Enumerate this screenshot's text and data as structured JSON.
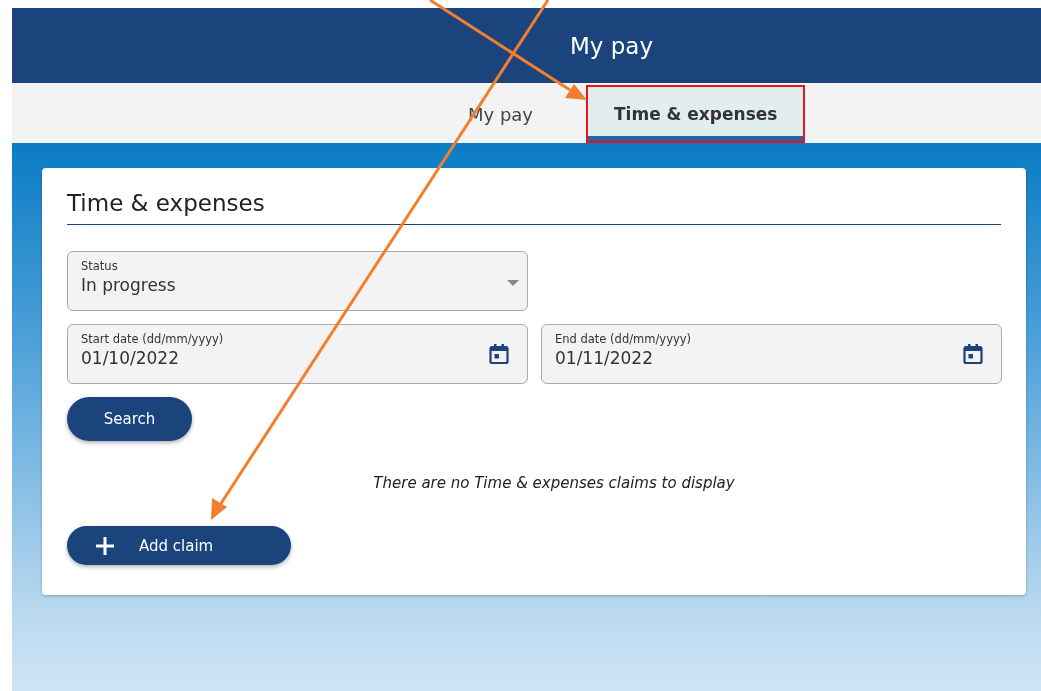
{
  "header": {
    "title": "My pay"
  },
  "tabs": [
    {
      "label": "My pay",
      "selected": false,
      "highlighted": false
    },
    {
      "label": "Time & expenses",
      "selected": true,
      "highlighted": true
    }
  ],
  "card": {
    "title": "Time & expenses",
    "status": {
      "label": "Status",
      "value": "In progress"
    },
    "dates": [
      {
        "label": "Start date (dd/mm/yyyy)",
        "value": "01/10/2022"
      },
      {
        "label": "End date (dd/mm/yyyy)",
        "value": "01/11/2022"
      }
    ],
    "search_button": "Search",
    "empty_message": "There are no Time & expenses claims to display",
    "add_button": "Add claim"
  }
}
